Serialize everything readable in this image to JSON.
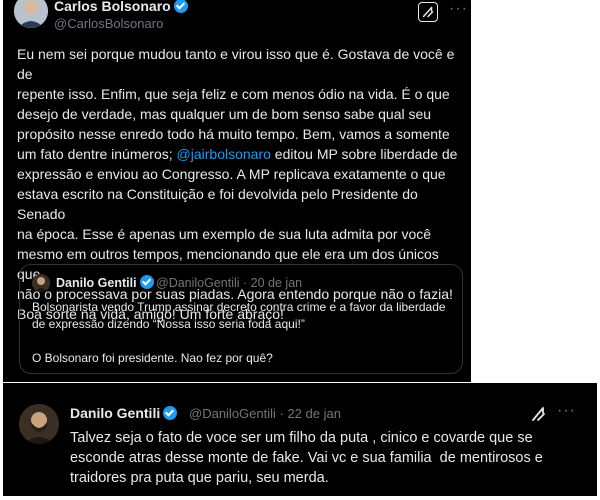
{
  "tweet1": {
    "author_name": "Carlos Bolsonaro",
    "author_handle": "@CarlosBolsonaro",
    "body_before_mention": "Eu nem sei porque mudou tanto e virou isso que é. Gostava de você e de\nrepente isso. Enfim, que seja feliz e com menos ódio na vida. É o que\ndesejo de verdade, mas qualquer um de bom senso sabe qual seu\npropósito nesse enredo todo há muito tempo. Bem, vamos a somente\num fato dentre inúmeros; ",
    "mention": "@jairbolsonaro",
    "body_after_mention": " editou MP sobre liberdade de\nexpressão e enviou ao Congresso. A MP replicava exatamente o que\nestava escrito na Constituição e foi devolvida pelo Presidente do Senado\nna época. Esse é apenas um exemplo de sua luta admita por você\nmesmo em outros tempos, mencionando que ele era um dos únicos que\nnão o processava por suas piadas. Agora entendo porque não o fazia!\nBoa sorte na vida, amigo! Um forte abraço!",
    "quoted": {
      "author_name": "Danilo Gentili",
      "meta": "@DaniloGentili · 20 de jan",
      "line1": "Bolsonarista vendo Trump assinar decreto contra crime e a favor da liberdade",
      "line2": "de expressão dizendo “Nossa isso seria foda aqui!”",
      "line3": "O Bolsonaro foi presidente. Nao fez por quê?"
    }
  },
  "tweet2": {
    "author_name": "Danilo Gentili",
    "meta": "@DaniloGentili · 22 de jan",
    "body": "Talvez seja o fato de voce ser um filho da puta , cinico e covarde que se\nesconde atras desse monte de fake. Vai vc e sua familia  de mentirosos e\ntraidores pra puta que pariu, seu merda."
  },
  "icons": {
    "verified": "verified-badge-icon",
    "grok": "grok-icon",
    "more": "more-icon"
  },
  "colors": {
    "background": "#000000",
    "text": "#e7e9ea",
    "secondary": "#71767b",
    "accent": "#1d9bf0"
  }
}
